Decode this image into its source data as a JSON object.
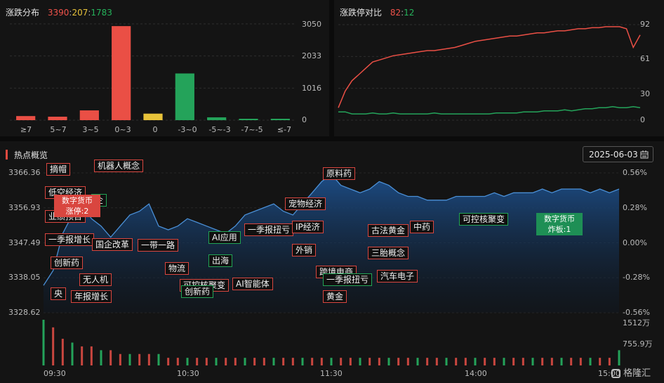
{
  "dist": {
    "title": "涨跌分布",
    "up": "3390",
    "flat": "207",
    "down": "1783",
    "sep": ":",
    "yticks": [
      "3050",
      "2033",
      "1016",
      "0"
    ],
    "categories": [
      "≥7",
      "5~7",
      "3~5",
      "0~3",
      "0",
      "-3~0",
      "-5~-3",
      "-7~-5",
      "≤-7"
    ]
  },
  "limit": {
    "title": "涨跌停对比",
    "up": "82",
    "down": "12",
    "sep": ":",
    "yticks": [
      "92",
      "61",
      "30",
      "0"
    ]
  },
  "hot": {
    "title": "热点概览",
    "date": "2025-06-03",
    "left_ticks": [
      "3366.36",
      "3356.93",
      "3347.49",
      "3338.05",
      "3328.62"
    ],
    "right_ticks": [
      "0.56%",
      "0.28%",
      "0.00%",
      "-0.28%",
      "-0.56%"
    ],
    "vol_ticks": [
      "1512万",
      "755.9万"
    ],
    "time_ticks": [
      "09:30",
      "10:30",
      "11:30",
      "14:00",
      "15:00"
    ],
    "tags": [
      {
        "text": "摘帽",
        "color": "red"
      },
      {
        "text": "机器人概念",
        "color": "red"
      },
      {
        "text": "低空经济",
        "color": "red"
      },
      {
        "text": "企",
        "color": "green"
      },
      {
        "text": "业绩预告",
        "color": "red"
      },
      {
        "text": "一季报增长",
        "color": "red"
      },
      {
        "text": "国企改革",
        "color": "red"
      },
      {
        "text": "创新药",
        "color": "red"
      },
      {
        "text": "一带一路",
        "color": "red"
      },
      {
        "text": "物流",
        "color": "red"
      },
      {
        "text": "无人机",
        "color": "red"
      },
      {
        "text": "央",
        "color": "red"
      },
      {
        "text": "年报增长",
        "color": "red"
      },
      {
        "text": "可控核聚变",
        "color": "red"
      },
      {
        "text": "创新药",
        "color": "green"
      },
      {
        "text": "AI应用",
        "color": "green"
      },
      {
        "text": "出海",
        "color": "green"
      },
      {
        "text": "AI智能体",
        "color": "red"
      },
      {
        "text": "一季报扭亏",
        "color": "red"
      },
      {
        "text": "宠物经济",
        "color": "red"
      },
      {
        "text": "IP经济",
        "color": "red"
      },
      {
        "text": "外销",
        "color": "red"
      },
      {
        "text": "原料药",
        "color": "red"
      },
      {
        "text": "跨境电商",
        "color": "red"
      },
      {
        "text": "一季报扭亏",
        "color": "green"
      },
      {
        "text": "黄金",
        "color": "red"
      },
      {
        "text": "古法黄金",
        "color": "red"
      },
      {
        "text": "中药",
        "color": "red"
      },
      {
        "text": "三胎概念",
        "color": "red"
      },
      {
        "text": "汽车电子",
        "color": "red"
      },
      {
        "text": "可控核聚变",
        "color": "green"
      }
    ],
    "callouts": [
      {
        "title": "数字货币",
        "label": "涨停",
        "sep": ":",
        "value": "2",
        "color": "red"
      },
      {
        "title": "数字货币",
        "label": "炸板",
        "sep": ":",
        "value": "1",
        "color": "green"
      }
    ],
    "logo": "格隆汇"
  },
  "chart_data": [
    {
      "type": "bar",
      "title": "涨跌分布",
      "categories": [
        "≥7",
        "5~7",
        "3~5",
        "0~3",
        "0",
        "-3~0",
        "-5~-3",
        "-7~-5",
        "≤-7"
      ],
      "values": [
        130,
        110,
        310,
        2980,
        207,
        1480,
        90,
        25,
        30
      ],
      "colors": [
        "#ea4f45",
        "#ea4f45",
        "#ea4f45",
        "#ea4f45",
        "#e8c33a",
        "#24a35a",
        "#24a35a",
        "#24a35a",
        "#24a35a"
      ],
      "ylim": [
        0,
        3050
      ],
      "grid": true
    },
    {
      "type": "line",
      "title": "涨跌停对比",
      "ylim": [
        0,
        92
      ],
      "series": [
        {
          "color": "#ea4f45",
          "values": [
            12,
            28,
            38,
            44,
            50,
            56,
            58,
            60,
            62,
            63,
            64,
            65,
            66,
            67,
            67,
            68,
            69,
            70,
            72,
            74,
            76,
            77,
            78,
            79,
            80,
            81,
            81,
            82,
            83,
            84,
            84,
            85,
            86,
            86,
            87,
            88,
            88,
            89,
            89,
            90,
            90,
            90,
            88,
            70,
            82
          ]
        },
        {
          "color": "#24a35a",
          "values": [
            8,
            8,
            6,
            6,
            6,
            7,
            6,
            6,
            7,
            6,
            6,
            6,
            6,
            6,
            7,
            6,
            6,
            6,
            6,
            6,
            6,
            6,
            6,
            7,
            7,
            7,
            7,
            8,
            8,
            8,
            9,
            9,
            9,
            10,
            9,
            10,
            11,
            11,
            12,
            12,
            13,
            12,
            12,
            13,
            12
          ]
        }
      ]
    },
    {
      "type": "area",
      "title": "热点概览",
      "ylim": [
        3328.62,
        3366.36
      ],
      "series": [
        {
          "color": "#4a8fd6",
          "values": [
            3336,
            3340,
            3350,
            3355,
            3358,
            3354,
            3352,
            3349,
            3352,
            3355,
            3356,
            3358,
            3352,
            3351,
            3352,
            3354,
            3353,
            3352,
            3351,
            3350,
            3352,
            3355,
            3356,
            3357,
            3358,
            3356,
            3355,
            3358,
            3361,
            3364,
            3366,
            3363,
            3362,
            3361,
            3362,
            3364,
            3363,
            3361,
            3360,
            3360,
            3359,
            3359,
            3359,
            3360,
            3360,
            3360,
            3360,
            3361,
            3360,
            3361,
            3361,
            3361,
            3362,
            3361,
            3362,
            3362,
            3362,
            3361,
            3362,
            3361,
            3362
          ]
        }
      ],
      "volume": [
        12,
        10,
        7,
        6,
        5,
        5,
        4,
        4,
        3,
        3,
        3,
        3,
        3,
        2,
        2,
        2,
        2,
        2,
        2,
        2,
        2,
        2,
        2,
        2,
        2,
        2,
        2,
        2,
        2,
        2,
        2,
        2,
        2,
        2,
        2,
        2,
        2,
        2,
        2,
        2,
        2,
        2,
        2,
        2,
        2,
        2,
        2,
        2,
        2,
        2,
        2,
        2,
        2,
        2,
        2,
        2,
        2,
        2,
        2,
        2,
        4
      ]
    }
  ]
}
